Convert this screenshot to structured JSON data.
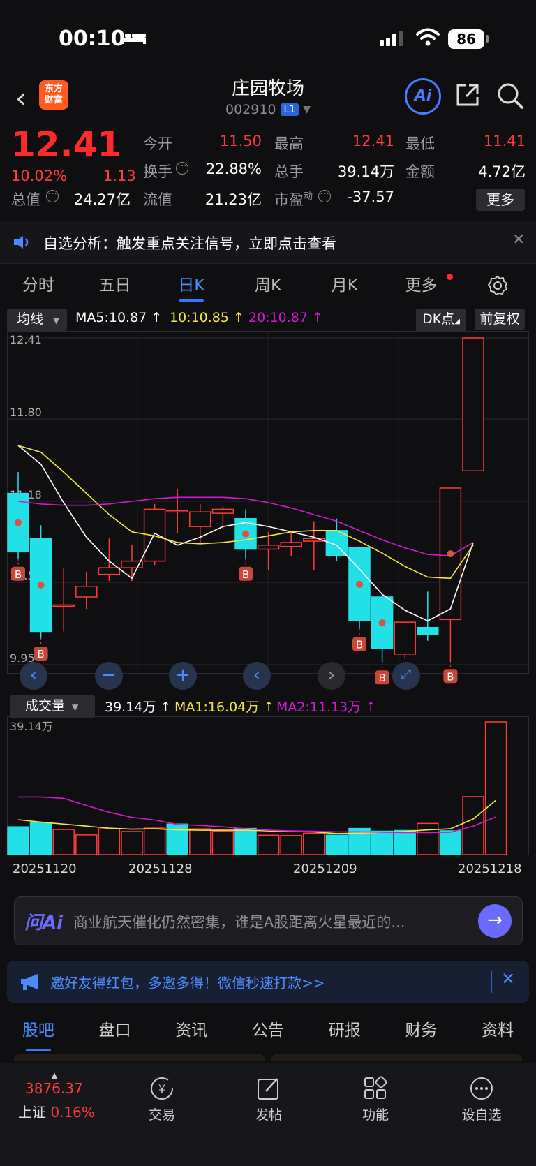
{
  "status_bar": {
    "time": "00:10",
    "battery": "86"
  },
  "header": {
    "name": "庄园牧场",
    "code": "002910",
    "level": "L1",
    "logo_line1": "东方",
    "logo_line2": "财富",
    "ai_label": "Ai"
  },
  "quote": {
    "price": "12.41",
    "change_pct": "10.02%",
    "change": "1.13",
    "fields": [
      {
        "label": "今开",
        "value": "11.50",
        "red": true
      },
      {
        "label": "最高",
        "value": "12.41",
        "red": true
      },
      {
        "label": "最低",
        "value": "11.41",
        "red": true
      },
      {
        "label": "换手",
        "value": "22.88%",
        "red": false
      },
      {
        "label": "总手",
        "value": "39.14万",
        "red": false
      },
      {
        "label": "金额",
        "value": "4.72亿",
        "red": false
      },
      {
        "label": "总值",
        "value": "24.27亿",
        "red": false
      },
      {
        "label": "流值",
        "value": "21.23亿",
        "red": false
      },
      {
        "label": "市盈",
        "value": "-37.57",
        "red": false
      }
    ],
    "more_label": "更多",
    "pe_sup": "动"
  },
  "notice": {
    "text": "自选分析：触发重点关注信号，立即点击查看"
  },
  "chart_tabs": [
    "分时",
    "五日",
    "日K",
    "周K",
    "月K",
    "更多"
  ],
  "chart_tabs_active": 2,
  "ma_bar": {
    "selector": "均线",
    "ma5": "MA5:10.87",
    "ma10": "10:10.85",
    "ma20": "20:10.87",
    "dk": "DK点",
    "fq": "前复权"
  },
  "colors": {
    "up": "#ff3b3b",
    "down": "#22e1e6",
    "ma5": "#ffffff",
    "ma10": "#f5e642",
    "ma20": "#d11ad1"
  },
  "chart_data": {
    "type": "candlestick",
    "price_labels": [
      "12.41",
      "11.80",
      "11.18",
      "10.57",
      "9.95"
    ],
    "y_range": [
      9.95,
      12.41
    ],
    "dates_shown": [
      "20251120",
      "20251128",
      "20251209",
      "20251218"
    ],
    "candles": [
      {
        "o": 11.24,
        "c": 10.8,
        "h": 11.4,
        "l": 10.75
      },
      {
        "o": 10.9,
        "c": 10.2,
        "h": 11.0,
        "l": 10.15
      },
      {
        "o": 10.4,
        "c": 10.4,
        "h": 10.68,
        "l": 10.2
      },
      {
        "o": 10.46,
        "c": 10.54,
        "h": 10.65,
        "l": 10.37
      },
      {
        "o": 10.63,
        "c": 10.68,
        "h": 10.9,
        "l": 10.58
      },
      {
        "o": 10.68,
        "c": 10.73,
        "h": 10.85,
        "l": 10.58
      },
      {
        "o": 10.73,
        "c": 11.12,
        "h": 11.16,
        "l": 10.7
      },
      {
        "o": 11.11,
        "c": 11.11,
        "h": 11.27,
        "l": 10.94
      },
      {
        "o": 10.99,
        "c": 11.1,
        "h": 11.16,
        "l": 10.85
      },
      {
        "o": 11.09,
        "c": 11.12,
        "h": 11.14,
        "l": 10.97
      },
      {
        "o": 11.05,
        "c": 10.82,
        "h": 11.12,
        "l": 10.75
      },
      {
        "o": 10.82,
        "c": 10.85,
        "h": 10.95,
        "l": 10.66
      },
      {
        "o": 10.84,
        "c": 10.87,
        "h": 10.95,
        "l": 10.77
      },
      {
        "o": 10.88,
        "c": 10.9,
        "h": 11.03,
        "l": 10.66
      },
      {
        "o": 10.96,
        "c": 10.77,
        "h": 11.05,
        "l": 10.73
      },
      {
        "o": 10.83,
        "c": 10.28,
        "h": 10.84,
        "l": 10.22
      },
      {
        "o": 10.46,
        "c": 10.07,
        "h": 10.48,
        "l": 9.97
      },
      {
        "o": 10.03,
        "c": 10.27,
        "h": 10.28,
        "l": 10.0
      },
      {
        "o": 10.23,
        "c": 10.18,
        "h": 10.5,
        "l": 10.13
      },
      {
        "o": 10.29,
        "c": 11.28,
        "h": 11.28,
        "l": 9.98
      },
      {
        "o": 11.41,
        "c": 12.41,
        "h": 12.41,
        "l": 11.41
      }
    ],
    "ma5": [
      11.6,
      11.46,
      11.17,
      10.91,
      10.73,
      10.6,
      10.94,
      10.85,
      10.91,
      10.99,
      11.02,
      10.99,
      10.95,
      10.91,
      10.85,
      10.67,
      10.48,
      10.36,
      10.28,
      10.37,
      10.87
    ],
    "ma10": [
      11.6,
      11.55,
      11.4,
      11.24,
      11.08,
      10.95,
      10.92,
      10.87,
      10.86,
      10.87,
      10.89,
      10.92,
      10.95,
      10.96,
      10.96,
      10.88,
      10.79,
      10.69,
      10.61,
      10.6,
      10.85
    ],
    "ma20": [
      11.18,
      11.16,
      11.15,
      11.15,
      11.16,
      11.18,
      11.2,
      11.21,
      11.21,
      11.21,
      11.2,
      11.17,
      11.13,
      11.08,
      11.03,
      10.96,
      10.89,
      10.83,
      10.78,
      10.77,
      10.87
    ],
    "buy_marks": [
      0,
      1,
      10,
      15,
      16,
      19
    ]
  },
  "nav_buttons": [
    "‹",
    "−",
    "+",
    "‹",
    "›"
  ],
  "vol_bar": {
    "selector": "成交量",
    "vol": "39.14万",
    "ma1": "MA1:16.04万",
    "ma2": "MA2:11.13万"
  },
  "vol_data": {
    "max_label": "39.14万",
    "values": [
      8.2,
      9.5,
      7.4,
      5.8,
      7.6,
      6.8,
      7.8,
      9.0,
      7.6,
      6.9,
      7.7,
      5.7,
      5.6,
      6.3,
      5.7,
      7.7,
      6.9,
      7.1,
      9.2,
      7.0,
      17.1,
      39.14
    ],
    "ma1": [
      10.3,
      9.6,
      9.0,
      8.4,
      7.8,
      7.5,
      7.6,
      7.3,
      7.2,
      7.2,
      7.2,
      7.0,
      6.8,
      6.7,
      6.2,
      6.3,
      6.6,
      6.8,
      7.3,
      7.6,
      10.5,
      16.04
    ],
    "ma2": [
      17.0,
      17.0,
      16.6,
      14.5,
      12.5,
      11.0,
      10.2,
      8.9,
      8.6,
      8.2,
      7.6,
      7.2,
      7.0,
      6.9,
      6.7,
      6.7,
      6.6,
      6.5,
      6.5,
      6.6,
      8.4,
      11.13
    ],
    "up": [
      false,
      false,
      true,
      true,
      true,
      true,
      true,
      false,
      true,
      true,
      false,
      true,
      true,
      true,
      false,
      false,
      false,
      false,
      true,
      false,
      true,
      true
    ]
  },
  "ask": {
    "logo": "问Ai",
    "text": "商业航天催化仍然密集，谁是A股距离火星最近的..."
  },
  "promo": {
    "text": "邀好友得红包，多邀多得！微信秒速打款>>"
  },
  "news_tabs": [
    "股吧",
    "盘口",
    "资讯",
    "公告",
    "研报",
    "财务",
    "资料"
  ],
  "footer": {
    "index_value": "3876.37",
    "index_name": "上证",
    "index_pct": "0.16%",
    "items": [
      "交易",
      "发帖",
      "功能",
      "设自选"
    ]
  }
}
